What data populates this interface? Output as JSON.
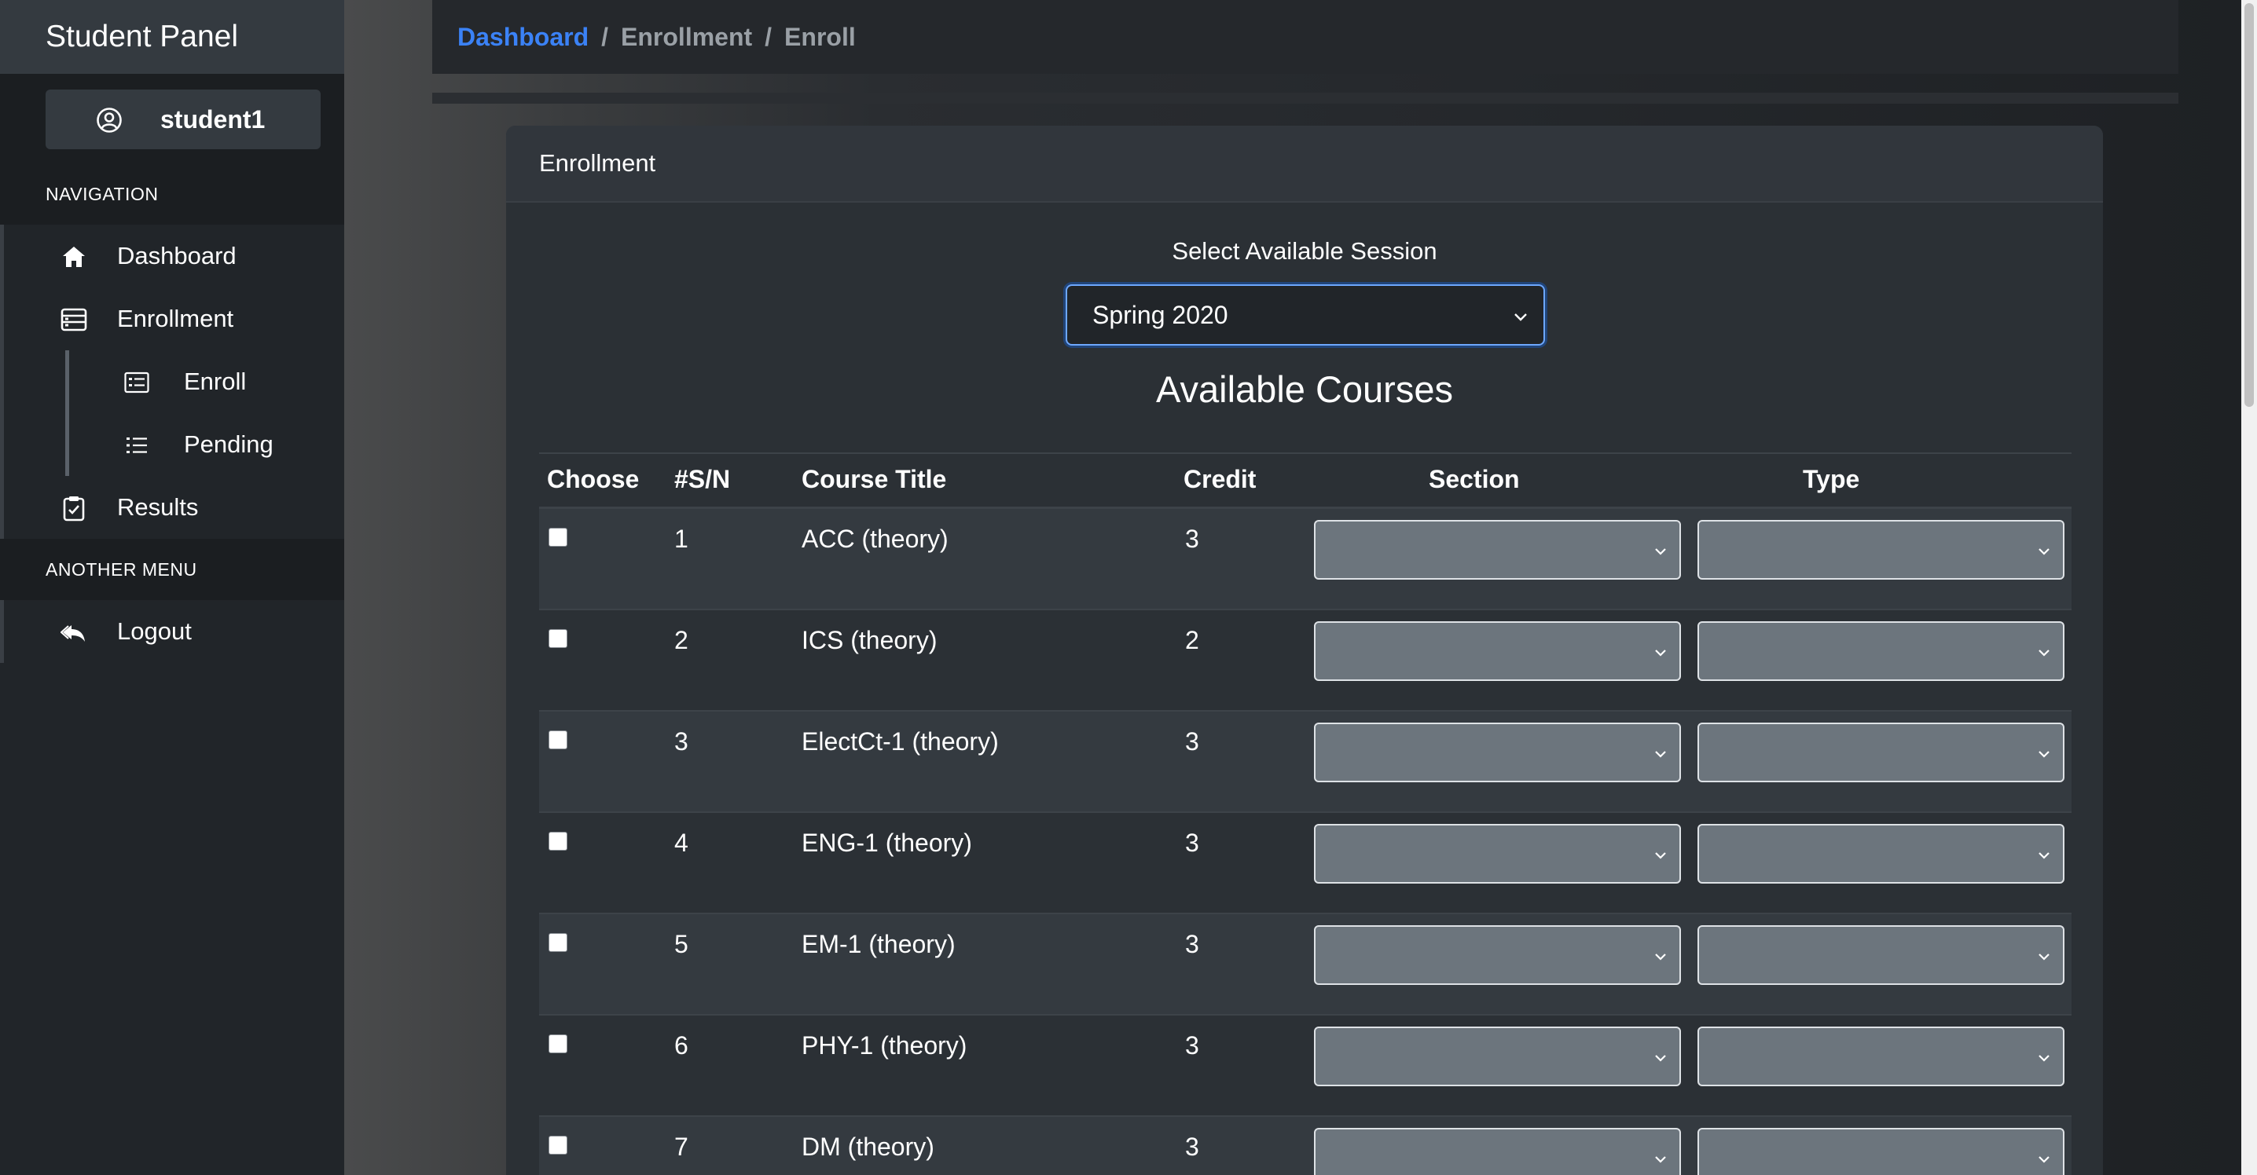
{
  "sidebar": {
    "brand": "Student Panel",
    "user": {
      "name": "student1",
      "icon": "user-circle-icon"
    },
    "nav_heading": "NAVIGATION",
    "items": [
      {
        "label": "Dashboard",
        "icon": "home-icon"
      },
      {
        "label": "Enrollment",
        "icon": "list-icon"
      }
    ],
    "sub_items": [
      {
        "label": "Enroll",
        "icon": "checklist-icon"
      },
      {
        "label": "Pending",
        "icon": "list-ol-icon"
      }
    ],
    "results": {
      "label": "Results",
      "icon": "clipboard-icon"
    },
    "another_heading": "ANOTHER MENU",
    "logout": {
      "label": "Logout",
      "icon": "reply-all-icon"
    }
  },
  "breadcrumb": {
    "items": [
      "Dashboard",
      "Enrollment",
      "Enroll"
    ],
    "separator": "/"
  },
  "card": {
    "title": "Enrollment",
    "session_label": "Select Available Session",
    "session_value": "Spring 2020",
    "courses_title": "Available Courses"
  },
  "table": {
    "headers": [
      "Choose",
      "#S/N",
      "Course Title",
      "Credit",
      "Section",
      "Type"
    ],
    "rows": [
      {
        "sn": "1",
        "title": "ACC (theory)",
        "credit": "3"
      },
      {
        "sn": "2",
        "title": "ICS (theory)",
        "credit": "2"
      },
      {
        "sn": "3",
        "title": "ElectCt-1 (theory)",
        "credit": "3"
      },
      {
        "sn": "4",
        "title": "ENG-1 (theory)",
        "credit": "3"
      },
      {
        "sn": "5",
        "title": "EM-1 (theory)",
        "credit": "3"
      },
      {
        "sn": "6",
        "title": "PHY-1 (theory)",
        "credit": "3"
      },
      {
        "sn": "7",
        "title": "DM (theory)",
        "credit": "3"
      }
    ]
  },
  "colors": {
    "accent": "#3b82f6",
    "sidebar_bg": "#212529",
    "brand_bg": "#343a40",
    "card_bg": "#2b3035",
    "select_bg": "#6c757d"
  }
}
